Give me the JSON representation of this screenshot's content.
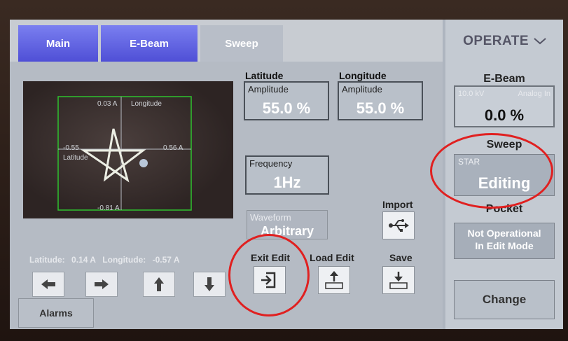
{
  "tabs": [
    {
      "label": "Main"
    },
    {
      "label": "E-Beam"
    },
    {
      "label": "Sweep"
    }
  ],
  "plot": {
    "top_label": "0.03 A",
    "longitude_label": "Longitude",
    "left_label": "-0.55",
    "latitude_label": "Latitude",
    "right_label": "0.56 A",
    "bottom_label": "-0.81 A"
  },
  "position": {
    "latitude_label": "Latitude:",
    "latitude_value": "0.14 A",
    "longitude_label": "Longitude:",
    "longitude_value": "-0.57 A"
  },
  "latitude": {
    "header": "Latitude",
    "label": "Amplitude",
    "value": "55.0 %"
  },
  "longitude": {
    "header": "Longitude",
    "label": "Amplitude",
    "value": "55.0 %"
  },
  "frequency": {
    "label": "Frequency",
    "value": "1Hz"
  },
  "waveform": {
    "label": "Waveform",
    "value": "Arbitrary"
  },
  "buttons": {
    "import": "Import",
    "exit_edit": "Exit Edit",
    "load_edit": "Load Edit",
    "save": "Save",
    "alarms": "Alarms"
  },
  "right_panel": {
    "operate": "OPERATE",
    "ebeam_header": "E-Beam",
    "kv": "10.0 kV",
    "analog": "Analog In",
    "ebeam_value": "0.0 %",
    "sweep_header": "Sweep",
    "sweep_mode": "STAR",
    "sweep_state": "Editing",
    "pocket_header": "Pocket",
    "pocket_line1": "Not Operational",
    "pocket_line2": "In Edit Mode",
    "change": "Change"
  },
  "icons": [
    "arrow-left-icon",
    "arrow-right-icon",
    "arrow-up-icon",
    "arrow-down-icon",
    "usb-icon",
    "exit-icon",
    "upload-icon",
    "download-icon",
    "chevron-down-icon"
  ],
  "colors": {
    "tab_blue": "#5a5ce0",
    "highlight_circle": "#e02020",
    "plot_border": "#2ec22e"
  }
}
